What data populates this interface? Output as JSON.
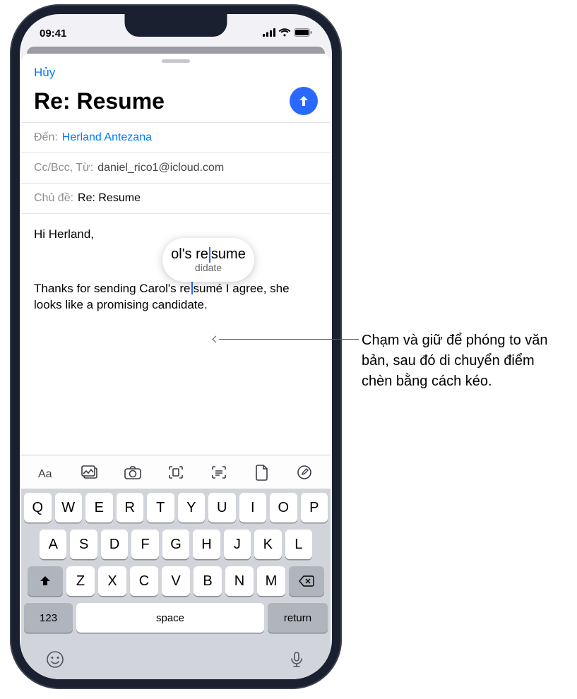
{
  "status": {
    "time": "09:41"
  },
  "compose": {
    "cancel": "Hủy",
    "subject_big": "Re: Resume",
    "to_label": "Đến:",
    "to_value": "Herland Antezana",
    "cc_label": "Cc/Bcc, Từ:",
    "cc_value": "daniel_rico1@icloud.com",
    "subj_label": "Chủ đề:",
    "subj_value": "Re: Resume",
    "body_hi": "Hi Herland,",
    "body_p_before": "Thanks for sending Carol's re",
    "body_p_after": "sumé I agree, she looks like a promising candidate.",
    "loupe_line1a": "ol's re",
    "loupe_line1b": "sume",
    "loupe_line2": "didate"
  },
  "toolbar_icons": [
    "format",
    "photos",
    "camera",
    "scan-doc",
    "scan-text",
    "file",
    "markup"
  ],
  "keyboard": {
    "row1": [
      "Q",
      "W",
      "E",
      "R",
      "T",
      "Y",
      "U",
      "I",
      "O",
      "P"
    ],
    "row2": [
      "A",
      "S",
      "D",
      "F",
      "G",
      "H",
      "J",
      "K",
      "L"
    ],
    "row3": [
      "Z",
      "X",
      "C",
      "V",
      "B",
      "N",
      "M"
    ],
    "num": "123",
    "space": "space",
    "return": "return"
  },
  "callout": "Chạm và giữ để phóng to văn bản, sau đó di chuyển điểm chèn bằng cách kéo."
}
